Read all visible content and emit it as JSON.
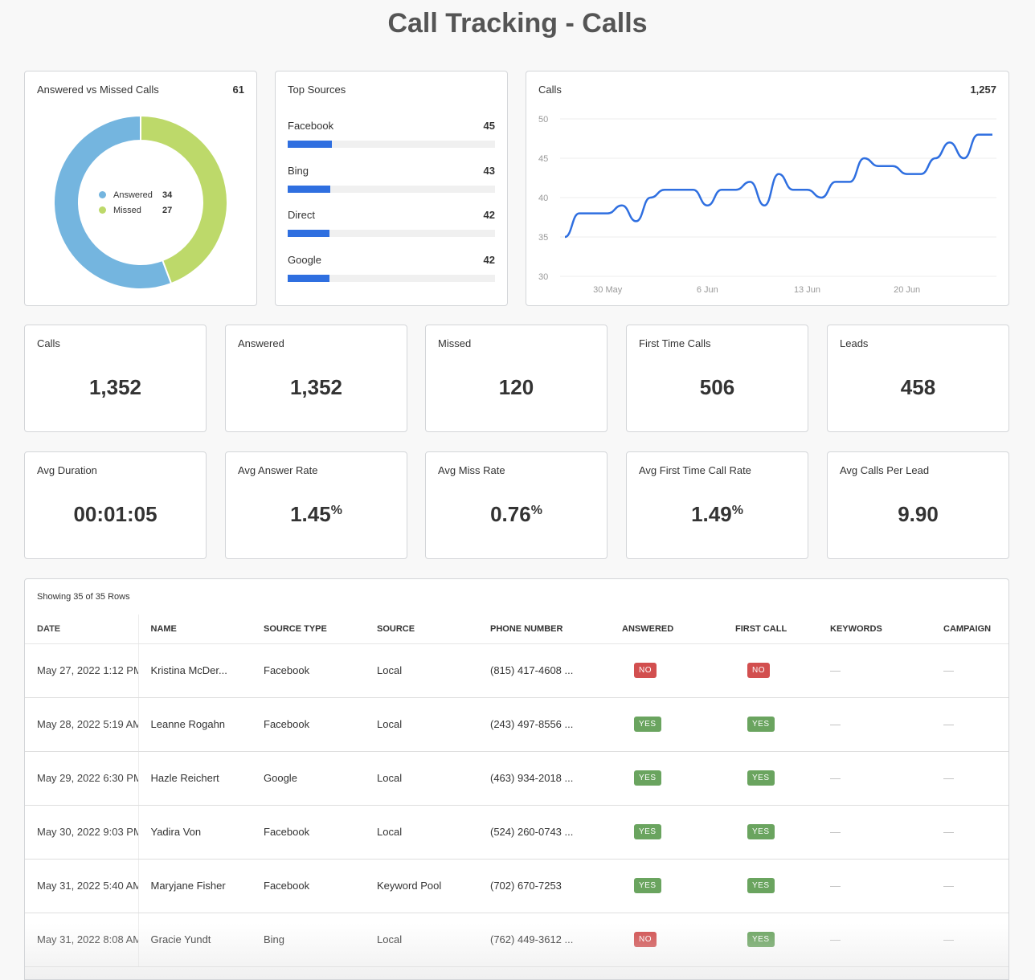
{
  "page": {
    "title": "Call Tracking - Calls"
  },
  "donut": {
    "title": "Answered vs Missed Calls",
    "total": "61",
    "segments": [
      {
        "label": "Answered",
        "value": 34,
        "color": "#74b5df"
      },
      {
        "label": "Missed",
        "value": 27,
        "color": "#bdd96a"
      }
    ]
  },
  "sources": {
    "title": "Top Sources",
    "scale_max": 210,
    "items": [
      {
        "label": "Facebook",
        "value": 45
      },
      {
        "label": "Bing",
        "value": 43
      },
      {
        "label": "Direct",
        "value": 42
      },
      {
        "label": "Google",
        "value": 42
      }
    ],
    "bar_color": "#2f6fe0"
  },
  "chart_data": {
    "type": "line",
    "title": "Calls",
    "total": "1,257",
    "xlabel": "",
    "ylabel": "",
    "ylim": [
      30,
      50
    ],
    "yticks": [
      30,
      35,
      40,
      45,
      50
    ],
    "xtick_labels": [
      {
        "label": "30 May",
        "index": 3
      },
      {
        "label": "6 Jun",
        "index": 10
      },
      {
        "label": "13 Jun",
        "index": 17
      },
      {
        "label": "20 Jun",
        "index": 24
      }
    ],
    "grid": true,
    "series": [
      {
        "name": "Calls",
        "color": "#2f6fe0",
        "x": [
          "27 May",
          "28 May",
          "29 May",
          "30 May",
          "31 May",
          "1 Jun",
          "2 Jun",
          "3 Jun",
          "4 Jun",
          "5 Jun",
          "6 Jun",
          "7 Jun",
          "8 Jun",
          "9 Jun",
          "10 Jun",
          "11 Jun",
          "12 Jun",
          "13 Jun",
          "14 Jun",
          "15 Jun",
          "16 Jun",
          "17 Jun",
          "18 Jun",
          "19 Jun",
          "20 Jun",
          "21 Jun",
          "22 Jun",
          "23 Jun",
          "24 Jun",
          "25 Jun",
          "26 Jun"
        ],
        "values": [
          35,
          38,
          38,
          38,
          39,
          37,
          40,
          41,
          41,
          41,
          39,
          41,
          41,
          42,
          39,
          43,
          41,
          41,
          40,
          42,
          42,
          45,
          44,
          44,
          43,
          43,
          45,
          47,
          45,
          48,
          48
        ]
      }
    ]
  },
  "stats_row1": [
    {
      "label": "Calls",
      "value": "1,352",
      "suffix": ""
    },
    {
      "label": "Answered",
      "value": "1,352",
      "suffix": ""
    },
    {
      "label": "Missed",
      "value": "120",
      "suffix": ""
    },
    {
      "label": "First Time Calls",
      "value": "506",
      "suffix": ""
    },
    {
      "label": "Leads",
      "value": "458",
      "suffix": ""
    }
  ],
  "stats_row2": [
    {
      "label": "Avg Duration",
      "value": "00:01:05",
      "suffix": ""
    },
    {
      "label": "Avg Answer Rate",
      "value": "1.45",
      "suffix": "%"
    },
    {
      "label": "Avg Miss Rate",
      "value": "0.76",
      "suffix": "%"
    },
    {
      "label": "Avg First Time Call Rate",
      "value": "1.49",
      "suffix": "%"
    },
    {
      "label": "Avg Calls Per Lead",
      "value": "9.90",
      "suffix": ""
    }
  ],
  "table": {
    "caption": "Showing 35 of 35 Rows",
    "columns": [
      "DATE",
      "NAME",
      "SOURCE TYPE",
      "SOURCE",
      "PHONE NUMBER",
      "ANSWERED",
      "FIRST CALL",
      "KEYWORDS",
      "CAMPAIGN"
    ],
    "empty_placeholder": "—",
    "badge_yes": "YES",
    "badge_no": "NO",
    "rows": [
      {
        "date": "May 27, 2022 1:12 PM",
        "name": "Kristina McDer...",
        "source_type": "Facebook",
        "source": "Local",
        "phone": "(815) 417-4608 ...",
        "answered": false,
        "first_call": false,
        "keywords": "—",
        "campaign": "—"
      },
      {
        "date": "May 28, 2022 5:19 AM",
        "name": "Leanne Rogahn",
        "source_type": "Facebook",
        "source": "Local",
        "phone": "(243) 497-8556 ...",
        "answered": true,
        "first_call": true,
        "keywords": "—",
        "campaign": "—"
      },
      {
        "date": "May 29, 2022 6:30 PM",
        "name": "Hazle Reichert",
        "source_type": "Google",
        "source": "Local",
        "phone": "(463) 934-2018 ...",
        "answered": true,
        "first_call": true,
        "keywords": "—",
        "campaign": "—"
      },
      {
        "date": "May 30, 2022 9:03 PM",
        "name": "Yadira Von",
        "source_type": "Facebook",
        "source": "Local",
        "phone": "(524) 260-0743 ...",
        "answered": true,
        "first_call": true,
        "keywords": "—",
        "campaign": "—"
      },
      {
        "date": "May 31, 2022 5:40 AM",
        "name": "Maryjane Fisher",
        "source_type": "Facebook",
        "source": "Keyword Pool",
        "phone": "(702) 670-7253",
        "answered": true,
        "first_call": true,
        "keywords": "—",
        "campaign": "—"
      },
      {
        "date": "May 31, 2022 8:08 AM",
        "name": "Gracie Yundt",
        "source_type": "Bing",
        "source": "Local",
        "phone": "(762) 449-3612 ...",
        "answered": false,
        "first_call": true,
        "keywords": "—",
        "campaign": "—"
      }
    ]
  }
}
